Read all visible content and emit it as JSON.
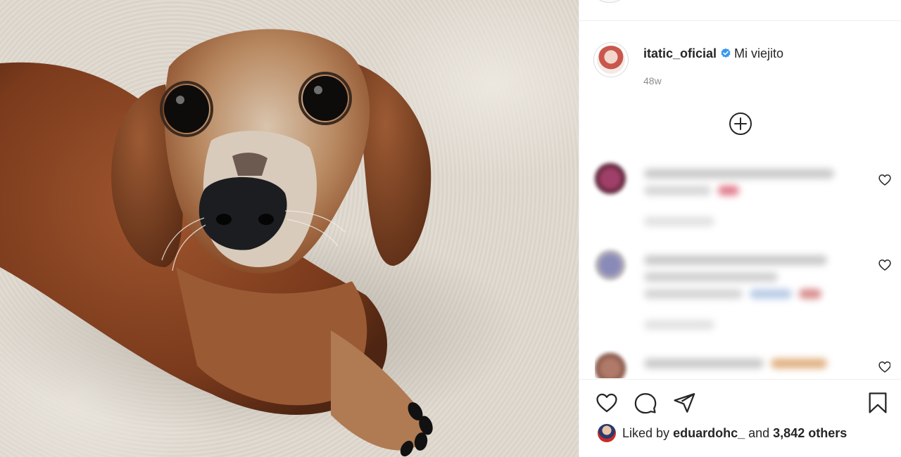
{
  "post": {
    "username": "itatic_oficial",
    "caption": "Mi viejito",
    "time_ago": "48w",
    "liked_by_prefix": "Liked by",
    "liked_by_user": "eduardohc_",
    "liked_by_and": "and",
    "liked_by_others": "3,842 others"
  },
  "icons": {
    "verified": "verified-badge-icon",
    "load_more": "plus-circle-icon",
    "like": "heart-icon",
    "comment": "comment-icon",
    "share": "send-icon",
    "save": "bookmark-icon"
  },
  "colors": {
    "verified_blue": "#3897f0",
    "text": "#262626",
    "secondary_text": "#8e8e8e"
  }
}
